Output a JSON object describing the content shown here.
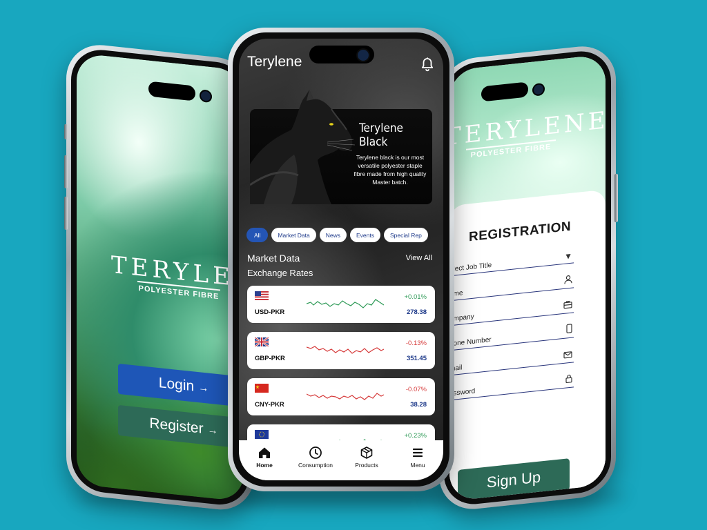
{
  "left_phone": {
    "brand": "TERYLENE",
    "brand_sub": "POLYESTER FIBRE",
    "login_label": "Login",
    "register_label": "Register",
    "arrow": "→"
  },
  "center_phone": {
    "app_title": "Terylene",
    "hero": {
      "title": "Terylene Black",
      "description": "Terylene black is our most versatile polyester staple fibre made from high quality Master batch."
    },
    "chips": [
      "All",
      "Market Data",
      "News",
      "Events",
      "Special Rep"
    ],
    "section_title": "Market Data",
    "section_subtitle": "Exchange Rates",
    "view_all": "View All",
    "rates": [
      {
        "pair": "USD-PKR",
        "change": "+0.01%",
        "value": "278.38",
        "trend": "up",
        "color": "#2e9a57"
      },
      {
        "pair": "GBP-PKR",
        "change": "-0.13%",
        "value": "351.45",
        "trend": "down",
        "color": "#d63a3a"
      },
      {
        "pair": "CNY-PKR",
        "change": "-0.07%",
        "value": "38.28",
        "trend": "down",
        "color": "#d63a3a"
      },
      {
        "pair": "",
        "change": "+0.23%",
        "value": "",
        "trend": "up",
        "color": "#2e9a57"
      }
    ],
    "nav": [
      {
        "label": "Home",
        "icon": "home-icon"
      },
      {
        "label": "Consumption",
        "icon": "clock-icon"
      },
      {
        "label": "Products",
        "icon": "box-icon"
      },
      {
        "label": "Menu",
        "icon": "menu-icon"
      }
    ]
  },
  "right_phone": {
    "brand": "TERYLENE",
    "brand_sub": "POLYESTER FIBRE",
    "form_title": "REGISTRATION",
    "fields": [
      {
        "label": "elect Job Title",
        "icon": "chevron-down-icon"
      },
      {
        "label": "ame",
        "icon": "user-icon"
      },
      {
        "label": "ompany",
        "icon": "briefcase-icon"
      },
      {
        "label": "hone Number",
        "icon": "phone-icon"
      },
      {
        "label": "mail",
        "icon": "mail-icon"
      },
      {
        "label": "assword",
        "icon": "lock-icon"
      }
    ],
    "signup_label": "Sign Up"
  },
  "colors": {
    "background": "#18a7bf",
    "login_button": "#1e56b7",
    "brand_green": "#2d6a57",
    "chip_active": "#2455b5",
    "positive": "#2e9a57",
    "negative": "#d63a3a"
  }
}
